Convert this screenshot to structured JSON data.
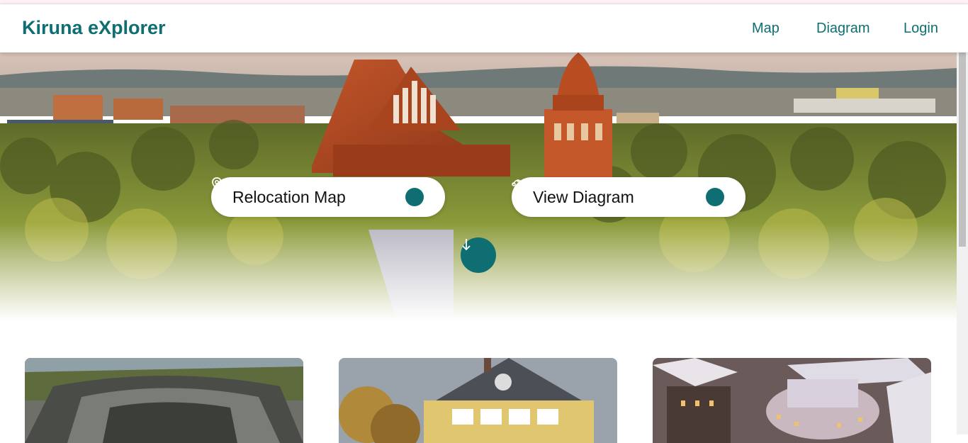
{
  "app": {
    "title": "Kiruna eXplorer"
  },
  "nav": {
    "items": [
      {
        "label": "Map"
      },
      {
        "label": "Diagram"
      },
      {
        "label": "Login"
      }
    ]
  },
  "hero": {
    "buttons": [
      {
        "label": "Relocation Map",
        "icon": "map-pin-icon"
      },
      {
        "label": "View Diagram",
        "icon": "diagram-icon"
      }
    ],
    "scroll_icon": "arrow-down-icon"
  },
  "colors": {
    "accent": "#0f6e72",
    "background": "#ffffff"
  },
  "cards": [
    {
      "image": "open-pit-mine-photo"
    },
    {
      "image": "yellow-house-photo"
    },
    {
      "image": "city-center-rendering"
    }
  ]
}
